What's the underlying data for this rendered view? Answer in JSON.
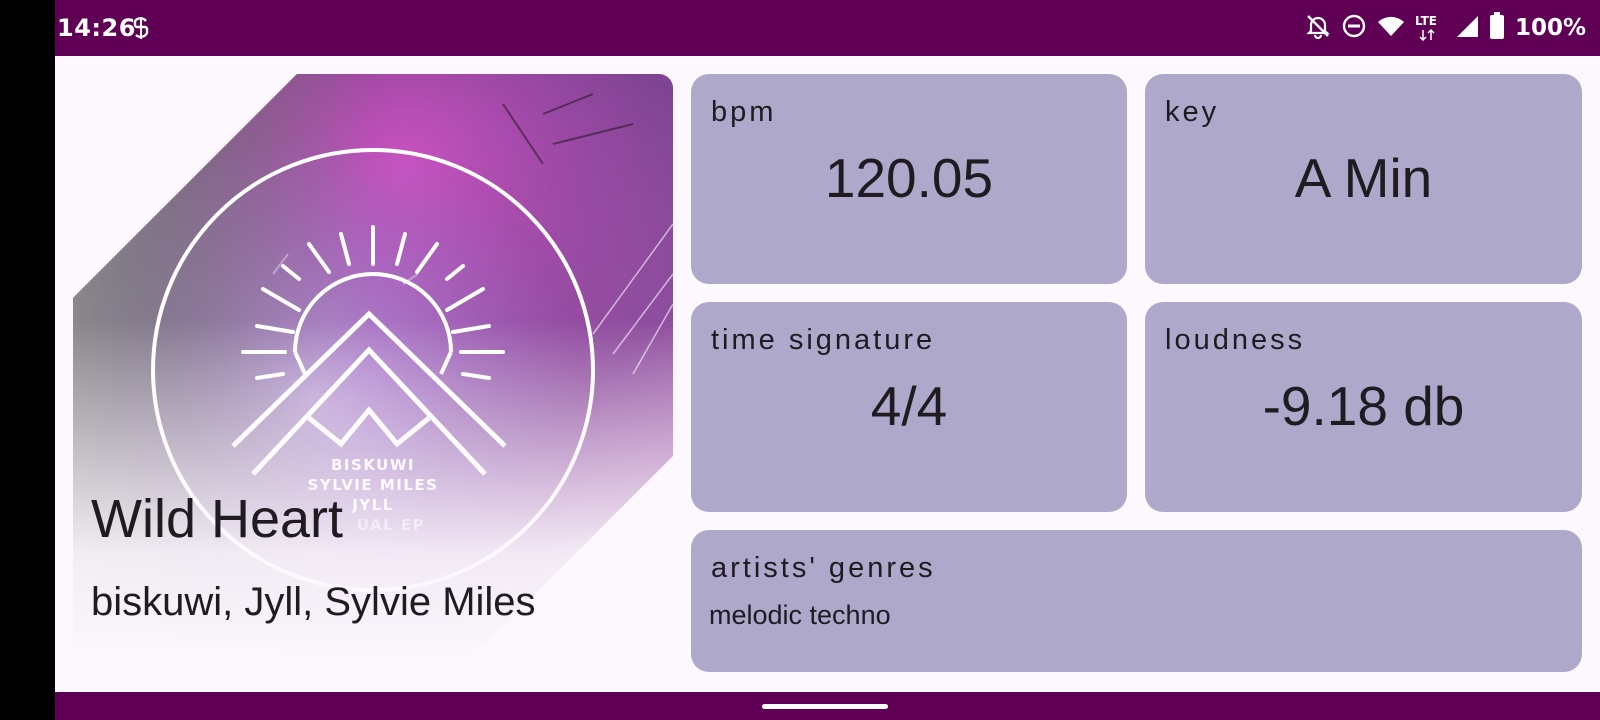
{
  "status_bar": {
    "time": "14:26",
    "battery": "100%",
    "network": "LTE",
    "icons": [
      "notifications-off-icon",
      "do-not-disturb-icon",
      "wifi-icon",
      "lte-icon",
      "cell-signal-icon",
      "battery-icon"
    ]
  },
  "track": {
    "title": "Wild Heart",
    "artists": "biskuwi, Jyll, Sylvie Miles",
    "cover": {
      "artist_lines": [
        "BISKUWI",
        "SYLVIE MILES",
        "JYLL"
      ],
      "ep_text": "UAL EP"
    }
  },
  "stats": {
    "bpm": {
      "label": "bpm",
      "value": "120.05"
    },
    "key": {
      "label": "key",
      "value": "A Min"
    },
    "time_signature": {
      "label": "time signature",
      "value": "4/4"
    },
    "loudness": {
      "label": "loudness",
      "value": "-9.18 db"
    }
  },
  "genres": {
    "label": "artists' genres",
    "value": "melodic techno"
  },
  "colors": {
    "bar": "#5f0055",
    "card": "#aea8cb",
    "background": "#fcf8fd"
  }
}
